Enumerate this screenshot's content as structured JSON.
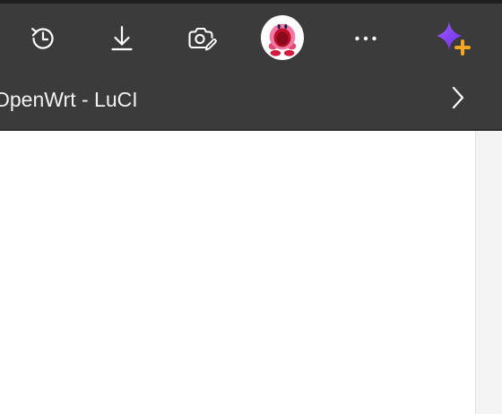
{
  "toolbar": {
    "icons": [
      {
        "name": "history-icon"
      },
      {
        "name": "download-icon"
      },
      {
        "name": "screenshot-icon"
      },
      {
        "name": "profile-avatar"
      },
      {
        "name": "more-options-icon"
      },
      {
        "name": "copilot-sparkle-icon"
      }
    ]
  },
  "tab": {
    "title": "OpenWrt - LuCI"
  },
  "colors": {
    "toolbar_bg": "#3b3b3b",
    "icon_color": "#ffffff",
    "sparkle_purple": "#7b3cf5",
    "sparkle_orange": "#f5a623",
    "avatar_pink": "#f07aa6",
    "avatar_red": "#c0102a"
  }
}
